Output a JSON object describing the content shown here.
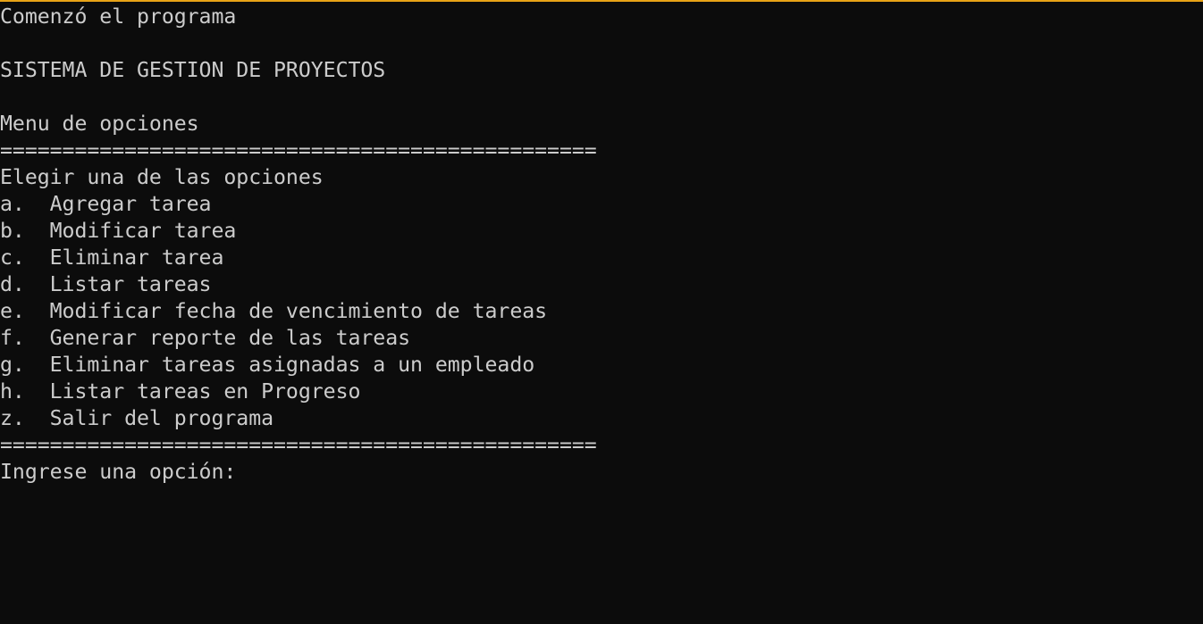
{
  "accent_color": "#e8a317",
  "lines": {
    "start": "Comenzó el programa",
    "blank1": "",
    "title": "SISTEMA DE GESTION DE PROYECTOS",
    "blank2": "",
    "menu_heading": "Menu de opciones",
    "separator_top": "================================================",
    "instruction": "Elegir una de las opciones",
    "options": [
      "a.  Agregar tarea",
      "b.  Modificar tarea",
      "c.  Eliminar tarea",
      "d.  Listar tareas",
      "e.  Modificar fecha de vencimiento de tareas",
      "f.  Generar reporte de las tareas",
      "g.  Eliminar tareas asignadas a un empleado",
      "h.  Listar tareas en Progreso",
      "z.  Salir del programa"
    ],
    "separator_bottom": "================================================",
    "prompt": "Ingrese una opción: "
  }
}
